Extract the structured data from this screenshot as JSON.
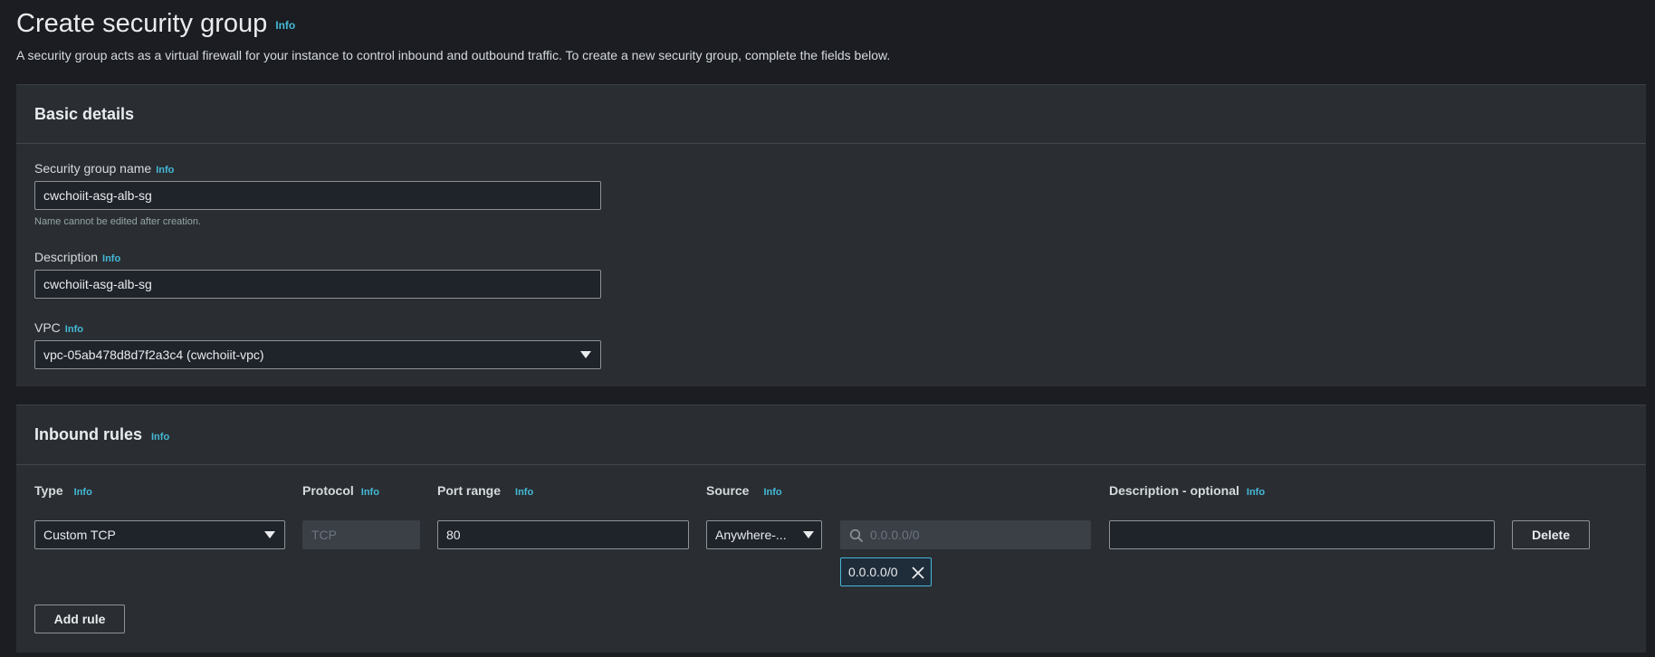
{
  "page": {
    "title": "Create security group",
    "info_label": "Info",
    "description": "A security group acts as a virtual firewall for your instance to control inbound and outbound traffic. To create a new security group, complete the fields below."
  },
  "basic_details": {
    "title": "Basic details",
    "name_label": "Security group name",
    "name_value": "cwchoiit-asg-alb-sg",
    "name_hint": "Name cannot be edited after creation.",
    "description_label": "Description",
    "description_value": "cwchoiit-asg-alb-sg",
    "vpc_label": "VPC",
    "vpc_value": "vpc-05ab478d8d7f2a3c4 (cwchoiit-vpc)"
  },
  "inbound_rules": {
    "title": "Inbound rules",
    "columns": {
      "type": "Type",
      "protocol": "Protocol",
      "port_range": "Port range",
      "source": "Source",
      "description": "Description - optional"
    },
    "rows": [
      {
        "type": "Custom TCP",
        "protocol": "TCP",
        "port_range": "80",
        "source": "Anywhere-...",
        "cidr_placeholder": "0.0.0.0/0",
        "cidr_token": "0.0.0.0/0",
        "description": "",
        "delete_label": "Delete"
      }
    ],
    "add_rule_label": "Add rule"
  },
  "icons": {
    "dropdown": "caret-down-icon",
    "search": "search-icon",
    "remove": "close-icon"
  },
  "colors": {
    "background": "#1b1d22",
    "panel": "#2a2e33",
    "info_link": "#44b9d6",
    "token_border": "#44b9d6"
  }
}
